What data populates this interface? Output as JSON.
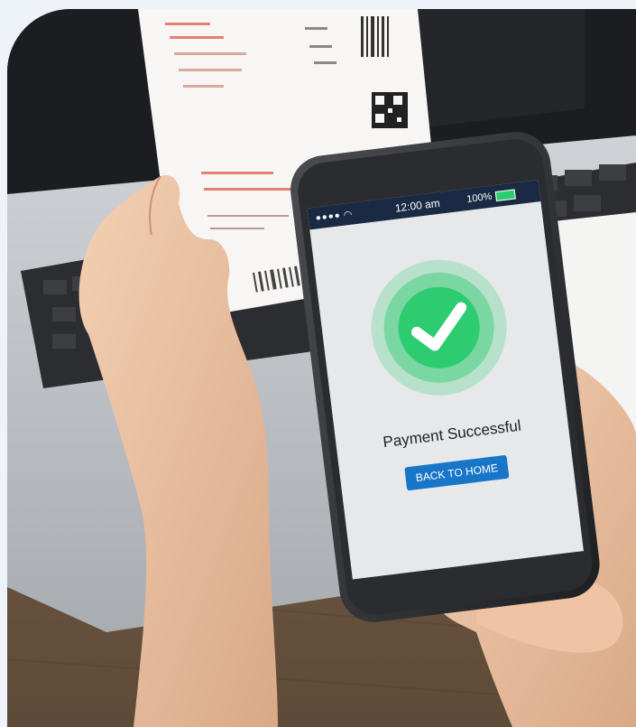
{
  "phone": {
    "status_bar": {
      "time": "12:00 am",
      "battery_percent": "100%",
      "signal_bars": 4
    },
    "screen": {
      "message": "Payment Successful",
      "button_label": "BACK TO HOME"
    },
    "colors": {
      "success_green": "#2ecc71",
      "button_blue": "#1876c8",
      "screen_bg": "#e6e8ea"
    }
  },
  "icons": [
    "wifi-icon",
    "battery-icon",
    "check-icon"
  ]
}
